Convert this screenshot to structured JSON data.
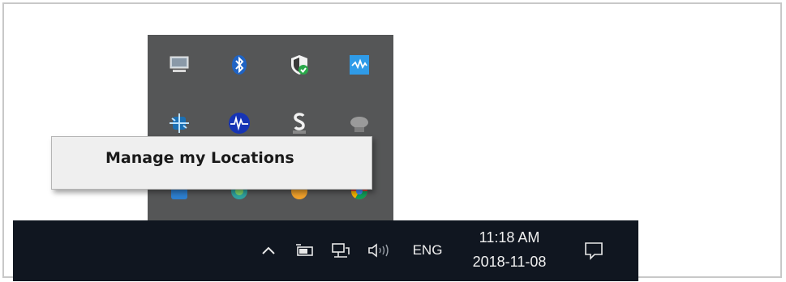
{
  "tray_flyout": {
    "icons": [
      {
        "name": "monitor-device-icon"
      },
      {
        "name": "bluetooth-icon"
      },
      {
        "name": "windows-defender-shield-icon"
      },
      {
        "name": "wave-app-icon"
      },
      {
        "name": "network-adapter-icon"
      },
      {
        "name": "audio-wave-icon"
      },
      {
        "name": "s-app-icon"
      },
      {
        "name": "cloud-sync-icon"
      },
      {
        "name": "blue-app-icon"
      },
      {
        "name": "green-app-icon"
      },
      {
        "name": "orange-app-icon"
      },
      {
        "name": "chrome-icon"
      }
    ]
  },
  "context_menu": {
    "items": [
      {
        "label": "Manage my Locations"
      }
    ]
  },
  "taskbar": {
    "language": "ENG",
    "time": "11:18 AM",
    "date": "2018-11-08",
    "icons": [
      "show-hidden-icons-chevron-icon",
      "power-battery-icon",
      "network-icon",
      "volume-icon",
      "action-center-icon"
    ]
  },
  "colors": {
    "taskbar_bg": "#101620",
    "flyout_bg": "#555657",
    "menu_bg": "#efefef"
  }
}
